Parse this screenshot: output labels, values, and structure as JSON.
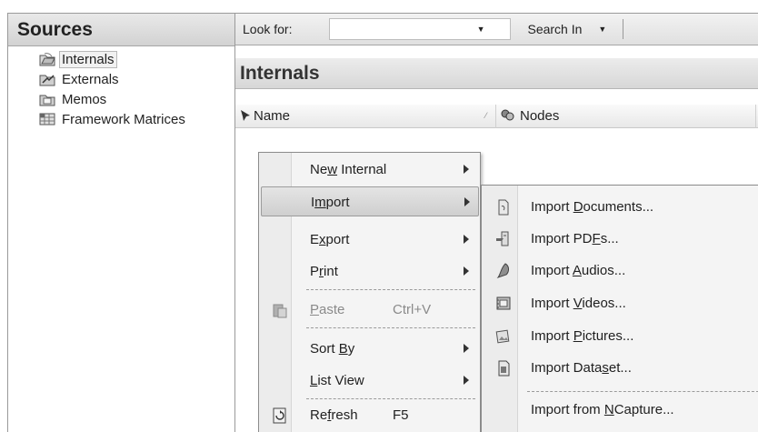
{
  "sources": {
    "title": "Sources",
    "items": [
      {
        "label": "Internals",
        "icon": "internals-folder-icon"
      },
      {
        "label": "Externals",
        "icon": "externals-folder-icon"
      },
      {
        "label": "Memos",
        "icon": "memos-folder-icon"
      },
      {
        "label": "Framework Matrices",
        "icon": "framework-matrices-icon"
      }
    ]
  },
  "find_bar": {
    "look_for_label": "Look for:",
    "look_for_value": "",
    "search_in_label": "Search In"
  },
  "detail": {
    "title": "Internals",
    "columns": {
      "name": "Name",
      "nodes": "Nodes"
    }
  },
  "context_menu": {
    "items": [
      {
        "pre": "Ne",
        "ul": "w",
        "post": " Internal",
        "submenu": true
      },
      {
        "pre": "I",
        "ul": "m",
        "post": "port",
        "submenu": true,
        "highlighted": true
      },
      {
        "pre": "E",
        "ul": "x",
        "post": "port",
        "submenu": true
      },
      {
        "pre": "P",
        "ul": "r",
        "post": "int",
        "submenu": true
      },
      {
        "pre": "",
        "ul": "P",
        "post": "aste",
        "shortcut": "Ctrl+V",
        "disabled": true,
        "icon": "paste-icon"
      },
      {
        "pre": "Sort ",
        "ul": "B",
        "post": "y",
        "submenu": true
      },
      {
        "pre": "",
        "ul": "L",
        "post": "ist View",
        "submenu": true
      },
      {
        "pre": "Re",
        "ul": "f",
        "post": "resh",
        "shortcut": "F5",
        "icon": "refresh-icon"
      }
    ]
  },
  "import_submenu": {
    "items": [
      {
        "pre": "Import ",
        "ul": "D",
        "post": "ocuments...",
        "icon": "import-documents-icon"
      },
      {
        "pre": "Import PD",
        "ul": "F",
        "post": "s...",
        "icon": "import-pdfs-icon"
      },
      {
        "pre": "Import ",
        "ul": "A",
        "post": "udios...",
        "icon": "import-audios-icon"
      },
      {
        "pre": "Import ",
        "ul": "V",
        "post": "ideos...",
        "icon": "import-videos-icon"
      },
      {
        "pre": "Import ",
        "ul": "P",
        "post": "ictures...",
        "icon": "import-pictures-icon"
      },
      {
        "pre": "Import Data",
        "ul": "s",
        "post": "et...",
        "icon": "import-dataset-icon"
      },
      {
        "pre": "Import from ",
        "ul": "N",
        "post": "Capture...",
        "icon": "import-ncapture-icon"
      }
    ]
  }
}
